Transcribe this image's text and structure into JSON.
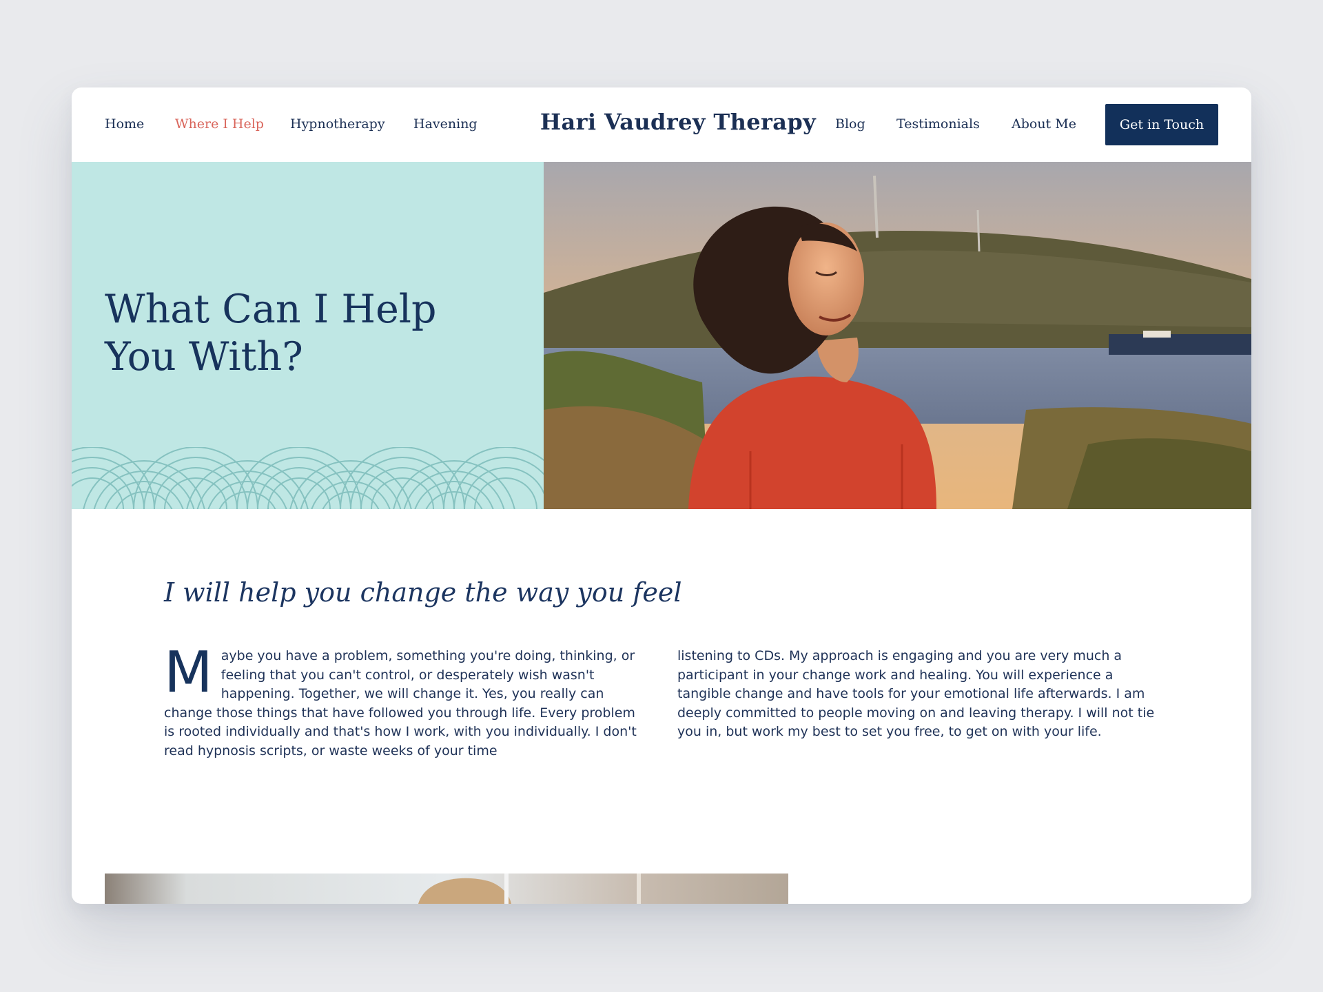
{
  "nav": {
    "left": [
      "Home",
      "Where I Help",
      "Hypnotherapy",
      "Havening"
    ],
    "brand": "Hari Vaudrey Therapy",
    "right": [
      "Blog",
      "Testimonials",
      "About Me"
    ],
    "cta": "Get in Touch",
    "active_item": "Where I Help"
  },
  "hero": {
    "title": "What Can I Help You With?",
    "background_color": "#bfe7e4",
    "photo": "woman-in-red-sweater-smiling-at-sunset"
  },
  "intro": {
    "subheading": "I will help you change the way you feel",
    "dropcap": "M",
    "column1": "aybe you have a problem, something you're doing, thinking, or feeling that you can't control, or desperately wish wasn't happening. Together, we will change it. Yes, you really can change those things that have followed you through life. Every problem is rooted individually and that's how I work, with you individually. I don't read hypnosis scripts, or waste weeks of your time",
    "column2": "listening to CDs. My approach is engaging and you are very much a participant in your change work and healing. You will experience a tangible change and have tools for your emotional life afterwards. I am deeply committed to people moving on and leaving therapy. I will not tie you in, but work my best to set you free, to get on with your life."
  },
  "colors": {
    "navy": "#12305a",
    "accent": "#d9655b",
    "mint": "#bfe7e4"
  }
}
